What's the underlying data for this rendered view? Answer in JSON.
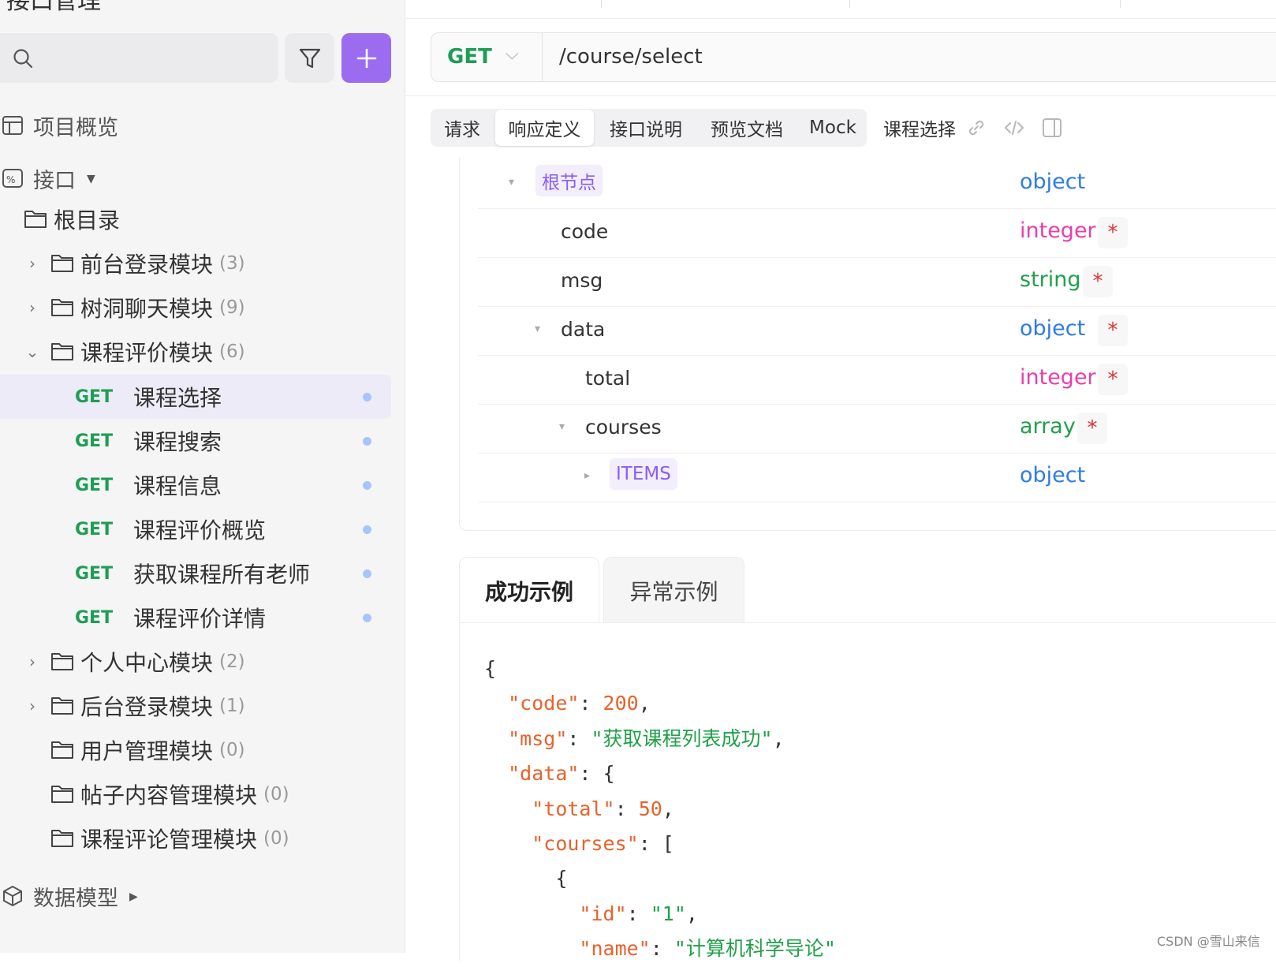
{
  "sidebar": {
    "title": "接口管理",
    "search": {
      "placeholder": ""
    },
    "overview_label": "项目概览",
    "interfaces_label": "接口",
    "data_models_label": "数据模型",
    "tree": [
      {
        "label": "根目录",
        "count": "",
        "chevron": "none"
      },
      {
        "label": "前台登录模块",
        "count": "(3)",
        "chevron": "right"
      },
      {
        "label": "树洞聊天模块",
        "count": "(9)",
        "chevron": "right"
      },
      {
        "label": "课程评价模块",
        "count": "(6)",
        "chevron": "down"
      }
    ],
    "apis": [
      {
        "method": "GET",
        "label": "课程选择",
        "active": true
      },
      {
        "method": "GET",
        "label": "课程搜索"
      },
      {
        "method": "GET",
        "label": "课程信息"
      },
      {
        "method": "GET",
        "label": "课程评价概览"
      },
      {
        "method": "GET",
        "label": "获取课程所有老师"
      },
      {
        "method": "GET",
        "label": "课程评价详情"
      }
    ],
    "tree2": [
      {
        "label": "个人中心模块",
        "count": "(2)",
        "chevron": "right"
      },
      {
        "label": "后台登录模块",
        "count": "(1)",
        "chevron": "right"
      },
      {
        "label": "用户管理模块",
        "count": "(0)",
        "chevron": "none"
      },
      {
        "label": "帖子内容管理模块",
        "count": "(0)",
        "chevron": "none"
      },
      {
        "label": "课程评论管理模块",
        "count": "(0)",
        "chevron": "none"
      }
    ]
  },
  "url_bar": {
    "method": "GET",
    "path": "/course/select"
  },
  "tabs": [
    "请求",
    "响应定义",
    "接口说明",
    "预览文档",
    "Mock"
  ],
  "active_tab": "响应定义",
  "current_api_title": "课程选择",
  "schema": [
    {
      "name": "根节点",
      "type": "object",
      "required": false,
      "badge": true,
      "toggle": "▾"
    },
    {
      "name": "code",
      "type": "integer",
      "required": true
    },
    {
      "name": "msg",
      "type": "string",
      "required": true
    },
    {
      "name": "data",
      "type": "object",
      "required": true,
      "toggle": "▾"
    },
    {
      "name": "total",
      "type": "integer",
      "required": true
    },
    {
      "name": "courses",
      "type": "array",
      "required": true,
      "toggle": "▾"
    },
    {
      "name": "ITEMS",
      "type": "object",
      "required": false,
      "badge": true,
      "toggle": "▸"
    }
  ],
  "required_mark": "*",
  "examples": {
    "success_label": "成功示例",
    "error_label": "异常示例"
  },
  "code_lines": {
    "l1": "{",
    "code_key": "\"code\"",
    "code_val": "200",
    "msg_key": "\"msg\"",
    "msg_val": "\"获取课程列表成功\"",
    "data_key": "\"data\"",
    "total_key": "\"total\"",
    "total_val": "50",
    "courses_key": "\"courses\"",
    "obj_open": "{",
    "id_key": "\"id\"",
    "id_val": "\"1\"",
    "name_key": "\"name\"",
    "name_val": "\"计算机科学导论\""
  },
  "watermark": "CSDN @雪山来信",
  "colors": {
    "accent": "#9b6cf0",
    "get": "#1f9d55",
    "object": "#2f7be6",
    "integer": "#e83fa8",
    "string": "#22a04a",
    "required": "#e5322d"
  }
}
